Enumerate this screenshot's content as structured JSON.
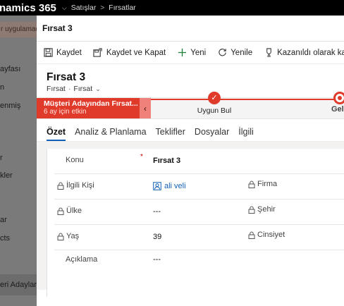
{
  "topnav": {
    "app_name": "namics 365",
    "crumb1": "Satışlar",
    "crumb2": "Fırsatlar"
  },
  "background": {
    "warning": "r uygulamad",
    "nav_items": [
      "ayfası",
      "n",
      "enmiş",
      "r",
      "kler",
      "ar",
      "cts",
      "eri Adayları"
    ]
  },
  "dialog": {
    "title": "Fırsat 3",
    "commands": {
      "save": "Kaydet",
      "save_close": "Kaydet ve Kapat",
      "new": "Yeni",
      "refresh": "Yenile",
      "won": "Kazanıldı olarak kapat"
    },
    "record": {
      "title": "Fırsat 3",
      "entity": "Fırsat",
      "form": "Fırsat"
    },
    "bpf": {
      "active_stage": "Müşteri Adayından Fırsat...",
      "active_duration": "6 ay için etkin",
      "stage1": "Uygun Bul",
      "stage2": "Geliştir"
    },
    "tabs": [
      "Özet",
      "Analiz & Planlama",
      "Teklifler",
      "Dosyalar",
      "İlgili"
    ],
    "fields": {
      "topic_label": "Konu",
      "topic_required": "*",
      "topic_value": "Fırsat 3",
      "contact_label": "İlgili Kişi",
      "contact_value": "ali veli",
      "company_label": "Firma",
      "country_label": "Ülke",
      "country_value": "---",
      "city_label": "Şehir",
      "age_label": "Yaş",
      "age_value": "39",
      "gender_label": "Cinsiyet",
      "desc_label": "Açıklama",
      "desc_value": "---"
    }
  },
  "colors": {
    "accent": "#e03a2b",
    "link": "#1160b7"
  }
}
